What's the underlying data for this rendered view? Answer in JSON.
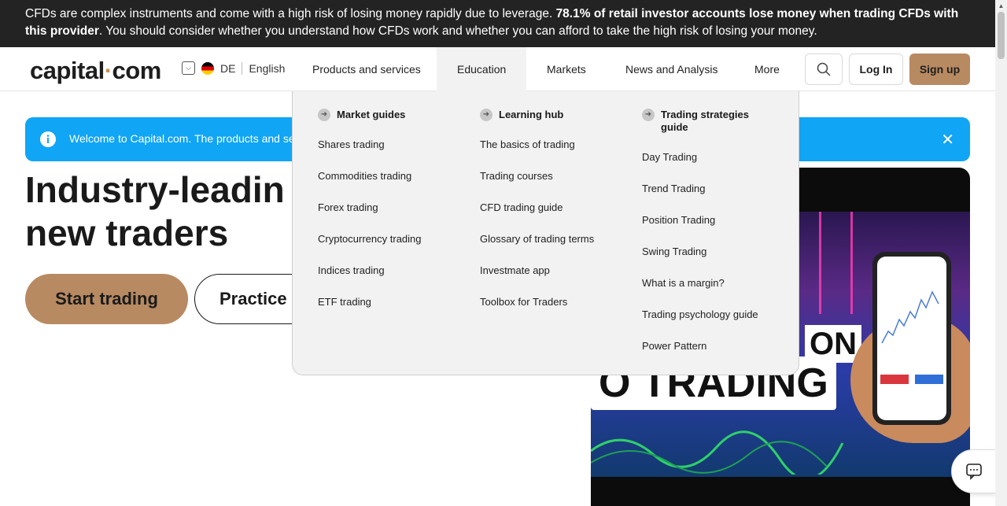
{
  "risk_banner": {
    "text_start": "CFDs are complex instruments and come with a high risk of losing money rapidly due to leverage. ",
    "text_bold": "78.1% of retail investor accounts lose money when trading CFDs with this provider",
    "text_end": ". You should consider whether you understand how CFDs work and whether you can afford to take the high risk of losing your money."
  },
  "header": {
    "logo_a": "capital",
    "logo_dot": "·",
    "logo_b": "com",
    "region_code": "DE",
    "language": "English",
    "nav": {
      "products": "Products and services",
      "education": "Education",
      "markets": "Markets",
      "news": "News and Analysis",
      "more": "More"
    },
    "login_label": "Log In",
    "signup_label": "Sign up"
  },
  "info_bar": {
    "message": "Welcome to Capital.com. The products and serv"
  },
  "hero": {
    "title_line1": "Industry-leadin",
    "title_line2": "new traders",
    "start_label": "Start trading",
    "practice_label": "Practice"
  },
  "video": {
    "word_main": "O TRADING",
    "word_side": "ON"
  },
  "mega_menu": {
    "col1": {
      "heading": "Market guides",
      "links": [
        "Shares trading",
        "Commodities trading",
        "Forex trading",
        "Cryptocurrency trading",
        "Indices trading",
        "ETF trading"
      ]
    },
    "col2": {
      "heading": "Learning hub",
      "links": [
        "The basics of trading",
        "Trading courses",
        "CFD trading guide",
        "Glossary of trading terms",
        "Investmate app",
        "Toolbox for Traders"
      ]
    },
    "col3": {
      "heading": "Trading strategies guide",
      "links": [
        "Day Trading",
        "Trend Trading",
        "Position Trading",
        "Swing Trading",
        "What is a margin?",
        "Trading psychology guide",
        "Power Pattern"
      ]
    }
  },
  "colors": {
    "brand_gold": "#b88a62",
    "info_blue": "#10a5f5",
    "banner_dark": "#232323"
  }
}
